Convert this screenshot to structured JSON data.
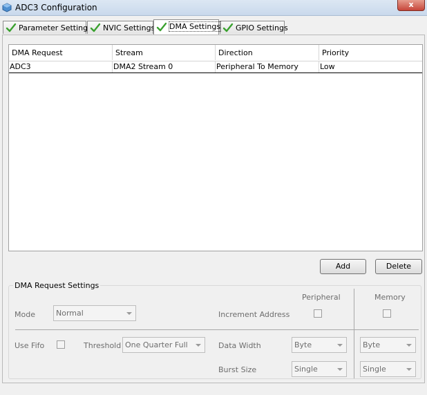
{
  "window": {
    "title": "ADC3 Configuration",
    "close_label": "x"
  },
  "tabs": [
    {
      "label": "Parameter Settings",
      "active": false
    },
    {
      "label": "NVIC Settings",
      "active": false
    },
    {
      "label": "DMA Settings",
      "active": true
    },
    {
      "label": "GPIO Settings",
      "active": false
    }
  ],
  "table": {
    "columns": [
      "DMA Request",
      "Stream",
      "Direction",
      "Priority"
    ],
    "rows": [
      [
        "ADC3",
        "DMA2 Stream 0",
        "Peripheral To Memory",
        "Low"
      ]
    ]
  },
  "buttons": {
    "add": "Add",
    "delete": "Delete"
  },
  "settings": {
    "title": "DMA Request Settings",
    "peripheral_header": "Peripheral",
    "memory_header": "Memory",
    "mode_label": "Mode",
    "mode_value": "Normal",
    "increment_label": "Increment Address",
    "increment_peripheral": false,
    "increment_memory": false,
    "fifo_label": "Use Fifo",
    "fifo_checked": false,
    "threshold_label": "Threshold",
    "threshold_value": "One Quarter Full",
    "data_width_label": "Data Width",
    "data_width_peripheral": "Byte",
    "data_width_memory": "Byte",
    "burst_label": "Burst Size",
    "burst_peripheral": "Single",
    "burst_memory": "Single"
  },
  "colors": {
    "accent_check": "#3aa12f",
    "disabled_text": "#6d6d6d",
    "selection_border": "#000000"
  }
}
